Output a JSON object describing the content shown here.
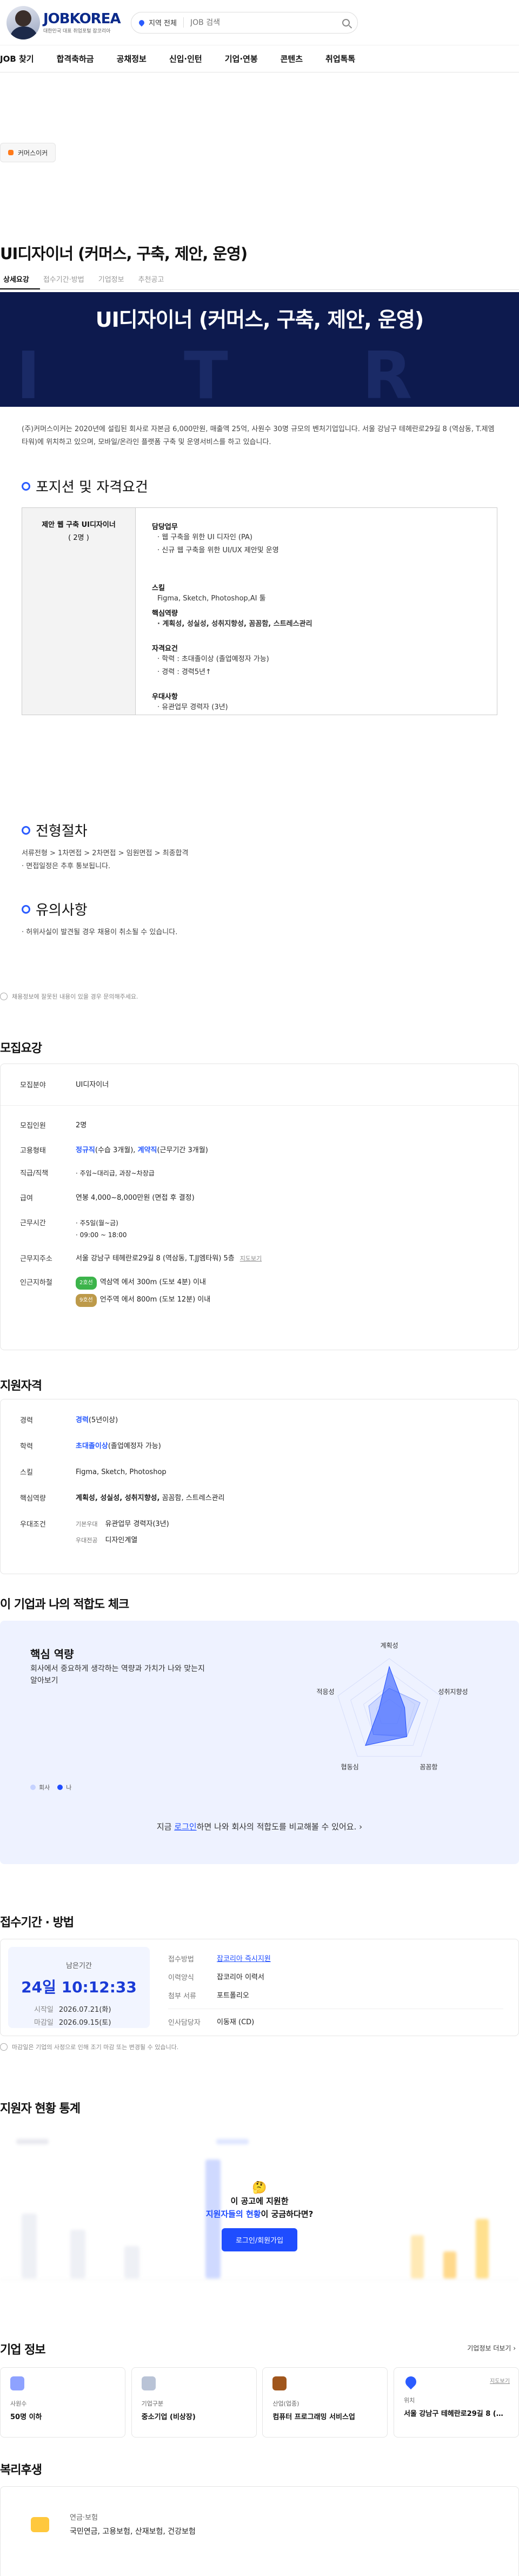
{
  "header": {
    "logo": "JOBKOREA",
    "logo_sub": "대한민국 대표 취업포털 잡코리아",
    "region": "지역 전체",
    "search_placeholder": "JOB 검색"
  },
  "nav": [
    "JOB 찾기",
    "합격축하금",
    "공채정보",
    "신입·인턴",
    "기업·연봉",
    "콘텐츠",
    "취업톡톡"
  ],
  "company_pill": "커머스이커",
  "job": {
    "title": "UI디자이너 (커머스, 구축, 제안, 운영)",
    "tabs": [
      "상세요강",
      "접수기간·방법",
      "기업정보",
      "추천공고"
    ],
    "banner_title": "UI디자이너 (커머스, 구축, 제안, 운영)",
    "intro": "(주)커머스이커는 2020년에 설립된 회사로 자본금 6,000만원, 매출액 25억, 사원수 30명 규모의 벤처기업입니다. 서울 강남구 테헤란로29길 8 (역삼동, T.제엠타워)에 위치하고 있으며, 모바일/온라인 플랫폼 구축 및 운영서비스를 하고 있습니다."
  },
  "position": {
    "heading": "포지션 및 자격요건",
    "name": "제안 웹 구축 UI디자이너",
    "count": "( 2명 )",
    "duty_k": "담당업무",
    "duty_v": [
      "웹 구축을 위한 UI 디자인 (PA)",
      "신규 웹 구축을 위한 UI/UX 제안및 운영"
    ],
    "skill_k": "스킬",
    "skill_v": "Figma, Sketch, Photoshop,AI 툴",
    "core_k": "핵심역량",
    "core_v": "계획성, 성실성, 성취지향성, 꼼꼼함, 스트레스관리",
    "qual_k": "자격요건",
    "qual_v": [
      "학력 : 초대졸이상 (졸업예정자 가능)",
      "경력 : 경력5년↑"
    ],
    "pref_k": "우대사항",
    "pref_v": "유관업무 경력자 (3년)"
  },
  "process": {
    "heading": "전형절차",
    "steps": "서류전형 > 1차면접 > 2차면접 > 임원면접 > 최종합격",
    "note": "· 면접일정은 추후 통보됩니다."
  },
  "caution": {
    "heading": "유의사항",
    "text": "· 허위사실이 발견될 경우 채용이 취소될 수 있습니다."
  },
  "report_note": "채용정보에 잘못된 내용이 있을 경우 문의해주세요.",
  "recruit": {
    "heading": "모집요강",
    "field_l": "모집분야",
    "field_v": "UI디자이너",
    "people_l": "모집인원",
    "people_v": "2명",
    "type_l": "고용형태",
    "type_a": "정규직",
    "type_a_sub": "(수습 3개월),",
    "type_b": "계약직",
    "type_b_sub": "(근무기간 3개월)",
    "rank_l": "직급/직책",
    "rank_v": "· 주임~대리급, 과장~차장급",
    "salary_l": "급여",
    "salary_v": "연봉 4,000~8,000만원 (면접 후 결정)",
    "time_l": "근무시간",
    "time_v1": "· 주5일(월~금)",
    "time_v2": "· 09:00 ~ 18:00",
    "addr_l": "근무지주소",
    "addr_v": "서울 강남구 테헤란로29길 8 (역삼동, T.JJ엠타워) 5층",
    "addr_link": "지도보기",
    "subway_l": "인근지하철",
    "sub1_tag": "2호선",
    "sub1": "역삼역 에서 300m (도보 4분) 이내",
    "sub2_tag": "9호선",
    "sub2": "언주역 에서 800m (도보 12분) 이내"
  },
  "qual": {
    "heading": "지원자격",
    "career_l": "경력",
    "career_a": "경력",
    "career_b": "(5년이상)",
    "edu_l": "학력",
    "edu_a": "초대졸이상",
    "edu_b": "(졸업예정자 가능)",
    "skill_l": "스킬",
    "skill_v": "Figma, Sketch, Photoshop",
    "core_l": "핵심역량",
    "core_a": "계획성, 성실성, 성취지향성,",
    "core_b": "꼼꼼함, 스트레스관리",
    "pref_l": "우대조건",
    "pref1_k": "기본우대",
    "pref1_v": "유관업무 경력자(3년)",
    "pref2_k": "우대전공",
    "pref2_v": "디자인계열"
  },
  "fit": {
    "heading": "이 기업과 나의 적합도 체크",
    "sub_heading": "핵심 역량",
    "desc": "회사에서 중요하게 생각하는 역량과 가치가 나와 맞는지 알아보기",
    "legend_company": "회사",
    "legend_me": "나",
    "axes": [
      "계획성",
      "성취지향성",
      "꼼꼼함",
      "협동심",
      "적응성"
    ],
    "cta_a": "지금",
    "cta_link": "로그인",
    "cta_b": "하면 나와 회사의 적합도를 비교해볼 수 있어요.",
    "colors": {
      "company": "#8fa8ff",
      "me": "#1f4dff"
    }
  },
  "apply": {
    "heading": "접수기간 · 방법",
    "remain_l": "남은기간",
    "remain_v": "24일 10:12:33",
    "start_l": "시작일",
    "start_v": "2026.07.21(화)",
    "end_l": "마감일",
    "end_v": "2026.09.15(토)",
    "method_l": "접수방법",
    "method_v": "잡코리아 즉시지원",
    "form_l": "이력양식",
    "form_v": "잡코리아 이력서",
    "doc_l": "첨부 서류",
    "doc_v": "포트폴리오",
    "manager_l": "인사담당자",
    "manager_v": "이동재 (CD)",
    "note": "마감일은 기업의 사정으로 인해 조기 마감 또는 변경될 수 있습니다."
  },
  "stats": {
    "heading": "지원자 현황 통계",
    "q1": "이 공고에 지원한",
    "q2_blue": "지원자들의 현황",
    "q2_rest": "이 궁금하다면?",
    "btn": "로그인/회원가입"
  },
  "company": {
    "heading": "기업 정보",
    "more": "기업정보 더보기",
    "cards": [
      {
        "k": "사원수",
        "v": "50명 이하",
        "color": "#8ea2ff"
      },
      {
        "k": "기업구분",
        "v": "중소기업 (비상장)",
        "color": "#b9c3d6"
      },
      {
        "k": "산업(업종)",
        "v": "컴퓨터 프로그래밍 서비스업",
        "color": "#a0561c"
      },
      {
        "k": "위치",
        "v": "서울 강남구 테헤란로29길 8 (역삼동)",
        "color": "#2b5cff",
        "link": "지도보기"
      }
    ]
  },
  "welfare": {
    "heading": "복리후생",
    "k": "연금·보험",
    "v": "국민연금, 고용보험, 산재보험, 건강보험"
  }
}
